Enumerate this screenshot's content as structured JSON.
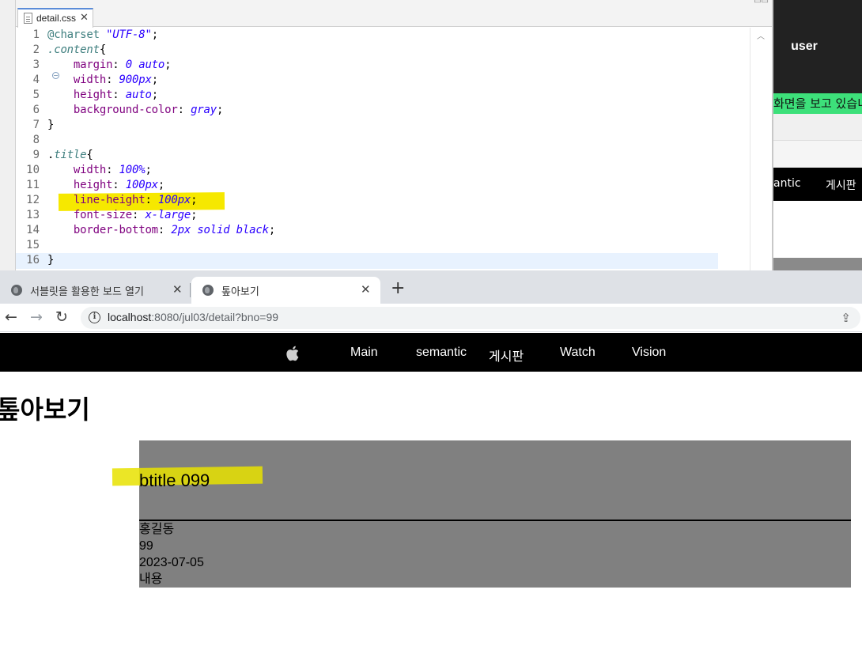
{
  "background_app": {
    "user_label": "user",
    "banner_text": "화면을 보고 있습니",
    "nav": [
      "antic",
      "게시판"
    ]
  },
  "editor": {
    "tab_label": "detail.css",
    "tab_close": "✕",
    "lines": [
      {
        "num": "1"
      },
      {
        "num": "2"
      },
      {
        "num": "3"
      },
      {
        "num": "4"
      },
      {
        "num": "5"
      },
      {
        "num": "6"
      },
      {
        "num": "7"
      },
      {
        "num": "8"
      },
      {
        "num": "9"
      },
      {
        "num": "10"
      },
      {
        "num": "11"
      },
      {
        "num": "12"
      },
      {
        "num": "13"
      },
      {
        "num": "14"
      },
      {
        "num": "15"
      },
      {
        "num": "16"
      }
    ],
    "code": {
      "charset_kw": "@charset",
      "charset_val": "\"UTF-8\"",
      "content_sel": ".content",
      "margin_prop": "margin",
      "margin_val": "0 auto",
      "width_prop": "width",
      "width_val": "900px",
      "height_prop": "height",
      "height_val": "auto",
      "bg_prop": "background-color",
      "bg_val": "gray",
      "title_sel": "title",
      "t_width_prop": "width",
      "t_width_val": "100%",
      "t_height_prop": "height",
      "t_height_val": "100px",
      "lh_prop": "line-height",
      "lh_val": "100px",
      "fs_prop": "font-size",
      "fs_val": "x-large",
      "bb_prop": "border-bottom",
      "bb_val": "2px solid black"
    }
  },
  "browser": {
    "tabs": [
      {
        "label": "서블릿을 활용한 보드 열기",
        "active": false
      },
      {
        "label": "톺아보기",
        "active": true
      }
    ],
    "new_tab": "+",
    "url_host": "localhost",
    "url_path": ":8080/jul03/detail?bno=99"
  },
  "site": {
    "nav": [
      "Main",
      "semantic",
      "게시판",
      "Watch",
      "Vision"
    ],
    "heading": "톺아보기",
    "board": {
      "title": "btitle 099",
      "writer": "홍길동",
      "bno": "99",
      "date": "2023-07-05",
      "content": "내용"
    }
  },
  "colors": {
    "highlight": "#f6e800",
    "content_bg": "gray",
    "nav_bg": "#000000"
  }
}
